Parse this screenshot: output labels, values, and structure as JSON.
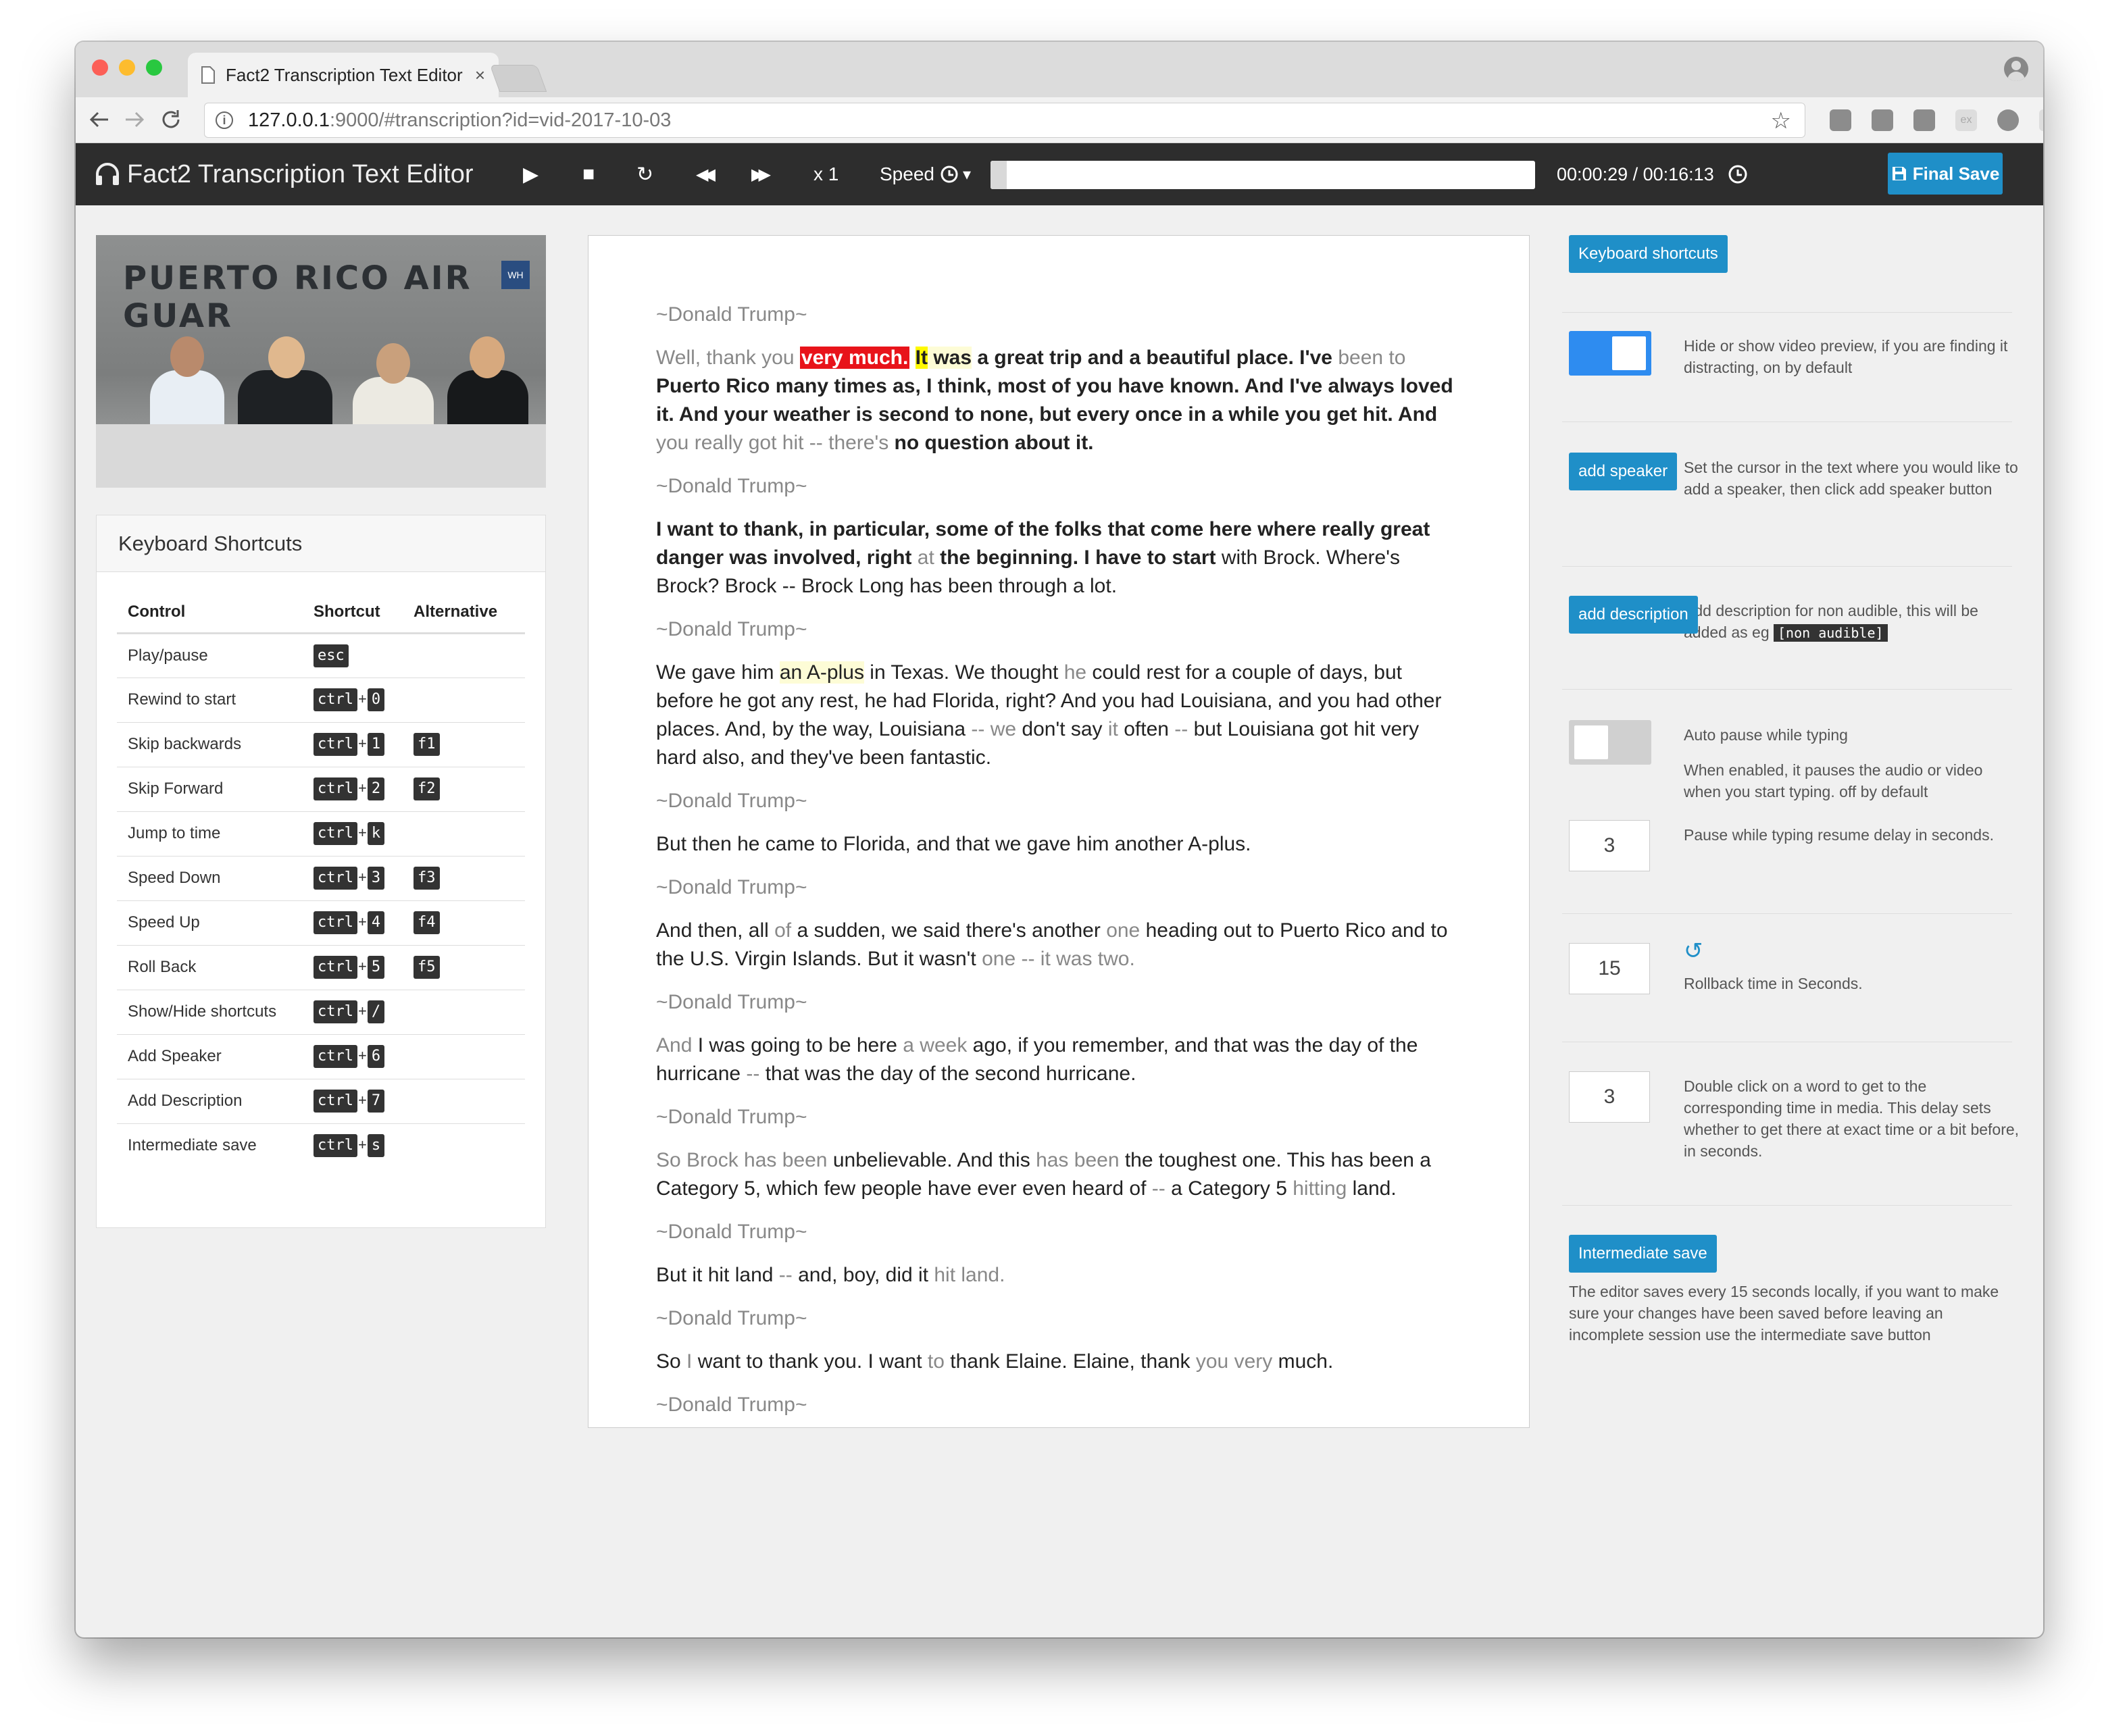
{
  "browser": {
    "tab_title": "Fact2 Transcription Text Editor",
    "tab_close": "×",
    "url_host": "127.0.0.1",
    "url_rest": ":9000/#transcription?id=vid-2017-10-03",
    "ext_label": "ex",
    "kebab": "⋮"
  },
  "toolbar": {
    "app_title": "Fact2 Transcription Text Editor",
    "play": "▶",
    "stop": "■",
    "rewind_start": "↻",
    "skip_back": "◀◀",
    "skip_forward": "▶▶",
    "speed_value": "x 1",
    "speed_label": "Speed",
    "speed_caret": "▾",
    "progress": 0.03,
    "time": "00:00:29 / 00:16:13",
    "final_save": "Final Save"
  },
  "video": {
    "sign_text": "PUERTO RICO AIR GUAR",
    "badge": "WH"
  },
  "shortcuts": {
    "title": "Keyboard Shortcuts",
    "headers": [
      "Control",
      "Shortcut",
      "Alternative"
    ],
    "rows": [
      {
        "control": "Play/pause",
        "keys": [
          "esc"
        ],
        "alt": ""
      },
      {
        "control": "Rewind to start",
        "keys": [
          "ctrl",
          "0"
        ],
        "alt": ""
      },
      {
        "control": "Skip backwards",
        "keys": [
          "ctrl",
          "1"
        ],
        "alt": "f1"
      },
      {
        "control": "Skip Forward",
        "keys": [
          "ctrl",
          "2"
        ],
        "alt": "f2"
      },
      {
        "control": "Jump to time",
        "keys": [
          "ctrl",
          "k"
        ],
        "alt": ""
      },
      {
        "control": "Speed Down",
        "keys": [
          "ctrl",
          "3"
        ],
        "alt": "f3"
      },
      {
        "control": "Speed Up",
        "keys": [
          "ctrl",
          "4"
        ],
        "alt": "f4"
      },
      {
        "control": "Roll Back",
        "keys": [
          "ctrl",
          "5"
        ],
        "alt": "f5"
      },
      {
        "control": "Show/Hide shortcuts",
        "keys": [
          "ctrl",
          "/"
        ],
        "alt": ""
      },
      {
        "control": "Add Speaker",
        "keys": [
          "ctrl",
          "6"
        ],
        "alt": ""
      },
      {
        "control": "Add Description",
        "keys": [
          "ctrl",
          "7"
        ],
        "alt": ""
      },
      {
        "control": "Intermediate save",
        "keys": [
          "ctrl",
          "s"
        ],
        "alt": ""
      }
    ]
  },
  "transcript": {
    "speaker": "~Donald Trump~",
    "blocks": [
      {
        "type": "speaker"
      },
      {
        "type": "para",
        "runs": [
          {
            "t": "Well, thank you ",
            "s": "g"
          },
          {
            "t": "very much.",
            "s": "red"
          },
          {
            "t": " ",
            "s": ""
          },
          {
            "t": "It",
            "s": "yel"
          },
          {
            "t": " was",
            "s": "bpale"
          },
          {
            "t": " a great trip and a beautiful place. I've",
            "s": "b"
          },
          {
            "t": " been to",
            "s": "g"
          },
          {
            "t": " Puerto Rico many times as, I think, most of you have known. And I've always loved it. And your weather is second to none, but every once in a while you get hit. And",
            "s": "b"
          },
          {
            "t": " you really got hit -- there's",
            "s": "g"
          },
          {
            "t": " no question about it.",
            "s": "b"
          }
        ]
      },
      {
        "type": "speaker"
      },
      {
        "type": "para",
        "runs": [
          {
            "t": "I want to thank, in particular, some of the folks that come here where really great danger was involved, right",
            "s": "b"
          },
          {
            "t": " at",
            "s": "g"
          },
          {
            "t": " the beginning. I have to start",
            "s": "b"
          },
          {
            "t": " with Brock. Where's Brock? Brock -- Brock Long has been through a lot.",
            "s": ""
          }
        ]
      },
      {
        "type": "speaker"
      },
      {
        "type": "para",
        "runs": [
          {
            "t": "We gave him ",
            "s": ""
          },
          {
            "t": "an A-plus",
            "s": "pale"
          },
          {
            "t": " in Texas. We thought ",
            "s": ""
          },
          {
            "t": "he",
            "s": "g"
          },
          {
            "t": " could rest for a couple of days, but before he got any rest, he had Florida, right? And you had Louisiana, and you had other places. And, by the way, Louisiana ",
            "s": ""
          },
          {
            "t": "-- we",
            "s": "g"
          },
          {
            "t": " don't say ",
            "s": ""
          },
          {
            "t": "it",
            "s": "g"
          },
          {
            "t": " often ",
            "s": ""
          },
          {
            "t": "--",
            "s": "g"
          },
          {
            "t": " but Louisiana got hit very hard also, and they've been fantastic.",
            "s": ""
          }
        ]
      },
      {
        "type": "speaker"
      },
      {
        "type": "para",
        "runs": [
          {
            "t": "But then he came to Florida, and that we gave him another A-plus.",
            "s": ""
          }
        ]
      },
      {
        "type": "speaker"
      },
      {
        "type": "para",
        "runs": [
          {
            "t": "And then, all ",
            "s": ""
          },
          {
            "t": "of",
            "s": "g"
          },
          {
            "t": " a sudden, we said there's another ",
            "s": ""
          },
          {
            "t": "one",
            "s": "g"
          },
          {
            "t": " heading out to Puerto Rico and to the U.S. Virgin Islands. But it wasn't ",
            "s": ""
          },
          {
            "t": "one -- it was two.",
            "s": "g"
          }
        ]
      },
      {
        "type": "speaker"
      },
      {
        "type": "para",
        "runs": [
          {
            "t": "And",
            "s": "g"
          },
          {
            "t": " I was going to be here ",
            "s": ""
          },
          {
            "t": "a week",
            "s": "g"
          },
          {
            "t": " ago, if you remember, and that was the day of the hurricane ",
            "s": ""
          },
          {
            "t": "--",
            "s": "g"
          },
          {
            "t": " that was the day of the second hurricane.",
            "s": ""
          }
        ]
      },
      {
        "type": "speaker"
      },
      {
        "type": "para",
        "runs": [
          {
            "t": "So Brock has been",
            "s": "g"
          },
          {
            "t": " unbelievable. And this ",
            "s": ""
          },
          {
            "t": "has been",
            "s": "g"
          },
          {
            "t": " the toughest one. This has been a Category 5, which few people have ever even heard of ",
            "s": ""
          },
          {
            "t": "--",
            "s": "g"
          },
          {
            "t": " a Category 5 ",
            "s": ""
          },
          {
            "t": "hitting",
            "s": "g"
          },
          {
            "t": " land.",
            "s": ""
          }
        ]
      },
      {
        "type": "speaker"
      },
      {
        "type": "para",
        "runs": [
          {
            "t": "But it hit land ",
            "s": ""
          },
          {
            "t": "--",
            "s": "g"
          },
          {
            "t": " and, boy, did it ",
            "s": ""
          },
          {
            "t": "hit land.",
            "s": "g"
          }
        ]
      },
      {
        "type": "speaker"
      },
      {
        "type": "para",
        "runs": [
          {
            "t": "So ",
            "s": ""
          },
          {
            "t": "I",
            "s": "g"
          },
          {
            "t": " want to thank you. I want ",
            "s": ""
          },
          {
            "t": "to",
            "s": "g"
          },
          {
            "t": " thank Elaine. Elaine, thank ",
            "s": ""
          },
          {
            "t": "you very",
            "s": "g"
          },
          {
            "t": " much.",
            "s": ""
          }
        ]
      },
      {
        "type": "speaker"
      }
    ]
  },
  "settings": {
    "keyboard_shortcuts_btn": "Keyboard shortcuts",
    "video_toggle_on": true,
    "video_toggle_desc": "Hide or show video preview, if you are finding it distracting, on by default",
    "add_speaker_btn": "add speaker",
    "add_speaker_desc": "Set the cursor in the text where you would like to add a speaker, then click add speaker button",
    "add_description_btn": "add description",
    "add_description_desc": "Add description for non audible, this will be added as eg",
    "non_audible_tag": "[non audible]",
    "auto_pause_on": false,
    "auto_pause_title": "Auto pause while typing",
    "auto_pause_desc": "When enabled, it pauses the audio or video when you start typing. off by default",
    "pause_delay_value": "3",
    "pause_delay_desc": "Pause while typing resume delay in seconds.",
    "rollback_value": "15",
    "rollback_icon": "↺",
    "rollback_desc": "Rollback time in Seconds.",
    "dblclick_value": "3",
    "dblclick_desc": "Double click on a word to get to the corresponding time in media. This delay sets whether to get there at exact time or a bit before, in seconds.",
    "intermediate_save_btn": "Intermediate save",
    "intermediate_save_desc": "The editor saves every 15 seconds locally, if you want to make sure your changes have been saved before leaving an incomplete session use the intermediate save button"
  },
  "colors": {
    "accent": "#1f8fc8",
    "toolbar_bg": "#2d2d2d",
    "highlight_red": "#e8131a",
    "highlight_yellow": "#fff900",
    "toggle_on": "#2e8cf0",
    "toggle_off": "#d0d0d0"
  }
}
